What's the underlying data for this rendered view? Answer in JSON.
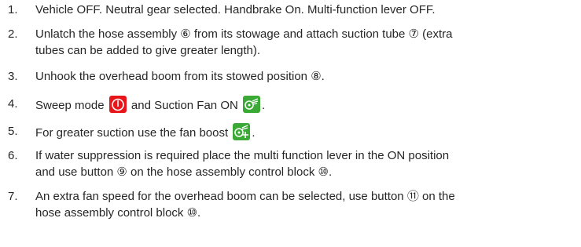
{
  "steps": [
    {
      "n": "1.",
      "text": "Vehicle OFF. Neutral gear selected. Handbrake On. Multi-function lever OFF."
    },
    {
      "n": "2.",
      "lines": [
        "Unlatch the hose assembly ⑥ from its stowage and attach suction tube ⑦ (extra",
        "tubes can be added to give greater length)."
      ]
    },
    {
      "n": "3.",
      "text": "Unhook the overhead boom from its stowed position ⑧."
    },
    {
      "n": "4.",
      "a": "Sweep mode",
      "b": "and Suction Fan ON",
      "c": "."
    },
    {
      "n": "5.",
      "a": "For greater suction use the fan boost",
      "c": "."
    },
    {
      "n": "6.",
      "lines": [
        "If water suppression is required place the multi function lever in the ON position",
        "and use button ⑨ on the hose assembly control block ⑩."
      ]
    },
    {
      "n": "7.",
      "lines": [
        "An extra fan speed for the overhead boom can be selected, use button ⑪ on the",
        "hose assembly control block ⑩."
      ]
    }
  ],
  "icons": {
    "sweep_mode": "power-icon",
    "suction_fan": "fan-icon",
    "fan_boost": "fan-boost-icon",
    "colors": {
      "red": "#e8151b",
      "green": "#3aa935"
    }
  }
}
